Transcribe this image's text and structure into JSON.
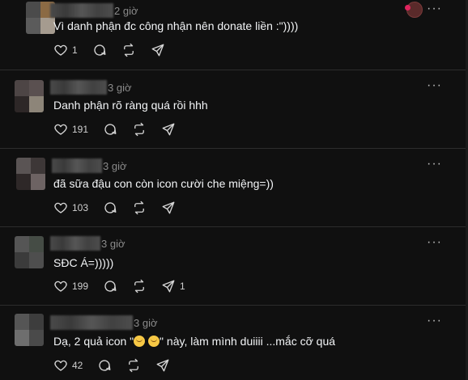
{
  "posts": [
    {
      "time": "2 giờ",
      "text": "Vì danh phận đc công nhận nên donate liền :\"))))",
      "likes": "1",
      "reposts": "",
      "shares": ""
    },
    {
      "time": "3 giờ",
      "text": "Danh phận rõ ràng quá rồi hhh",
      "likes": "191",
      "reposts": "",
      "shares": ""
    },
    {
      "time": "3 giờ",
      "text": "đã sữa đậu con còn icon cười che miệng=))",
      "likes": "103",
      "reposts": "",
      "shares": ""
    },
    {
      "time": "3 giờ",
      "text": "SĐC Á=)))))",
      "likes": "199",
      "reposts": "",
      "shares": "1"
    },
    {
      "time": "3 giờ",
      "text_before": "Dạ, 2 quả icon \"",
      "text_after": "\" này, làm mình duiiii ...mắc cỡ quá",
      "likes": "42",
      "reposts": "",
      "shares": ""
    }
  ],
  "icons": {
    "like": "heart-icon",
    "comment": "comment-icon",
    "repost": "repost-icon",
    "share": "share-icon",
    "more": "more-icon"
  },
  "colors": {
    "background": "#101010",
    "text": "#f3f5f7",
    "muted": "#8b8b8b",
    "divider": "#2d2d2d"
  }
}
